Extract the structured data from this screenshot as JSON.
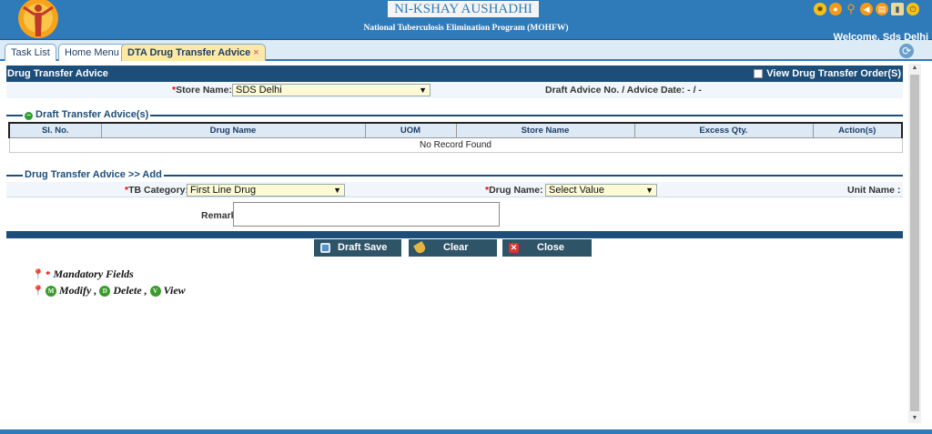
{
  "header": {
    "title": "NI-KSHAY AUSHADHI",
    "subtitle": "National Tuberculosis Elimination Program (MOHFW)",
    "welcome": "Welcome, Sds Delhi"
  },
  "tabs": [
    {
      "label": "Task List"
    },
    {
      "label": "Home Menu"
    },
    {
      "label": "DTA Drug Transfer Advice",
      "close": "×"
    }
  ],
  "page": {
    "title": "Drug Transfer Advice",
    "view_order_label": "View Drug Transfer Order(S)",
    "store_name_label": "Store Name:",
    "store_name_value": "SDS Delhi",
    "draft_advice_label": "Draft Advice No. / Advice Date: - / -"
  },
  "draft_section": {
    "legend": "Draft Transfer Advice(s)",
    "columns": [
      "Sl. No.",
      "Drug Name",
      "UOM",
      "Store Name",
      "Excess Qty.",
      "Action(s)"
    ],
    "empty_text": "No Record Found"
  },
  "add_section": {
    "legend": "Drug Transfer Advice >> Add",
    "tb_category_label": "TB Category:",
    "tb_category_value": "First Line Drug",
    "drug_name_label": "Drug Name:",
    "drug_name_value": "Select Value",
    "unit_name_label": "Unit Name :",
    "remarks_label": "Remarks:"
  },
  "buttons": {
    "draft_save": "Draft Save",
    "clear": "Clear",
    "close": "Close"
  },
  "notes": {
    "mandatory": "Mandatory Fields",
    "modify": "Modify ,",
    "delete": "Delete ,",
    "view": "View",
    "m": "M",
    "d": "D",
    "v": "V",
    "star": "*"
  }
}
